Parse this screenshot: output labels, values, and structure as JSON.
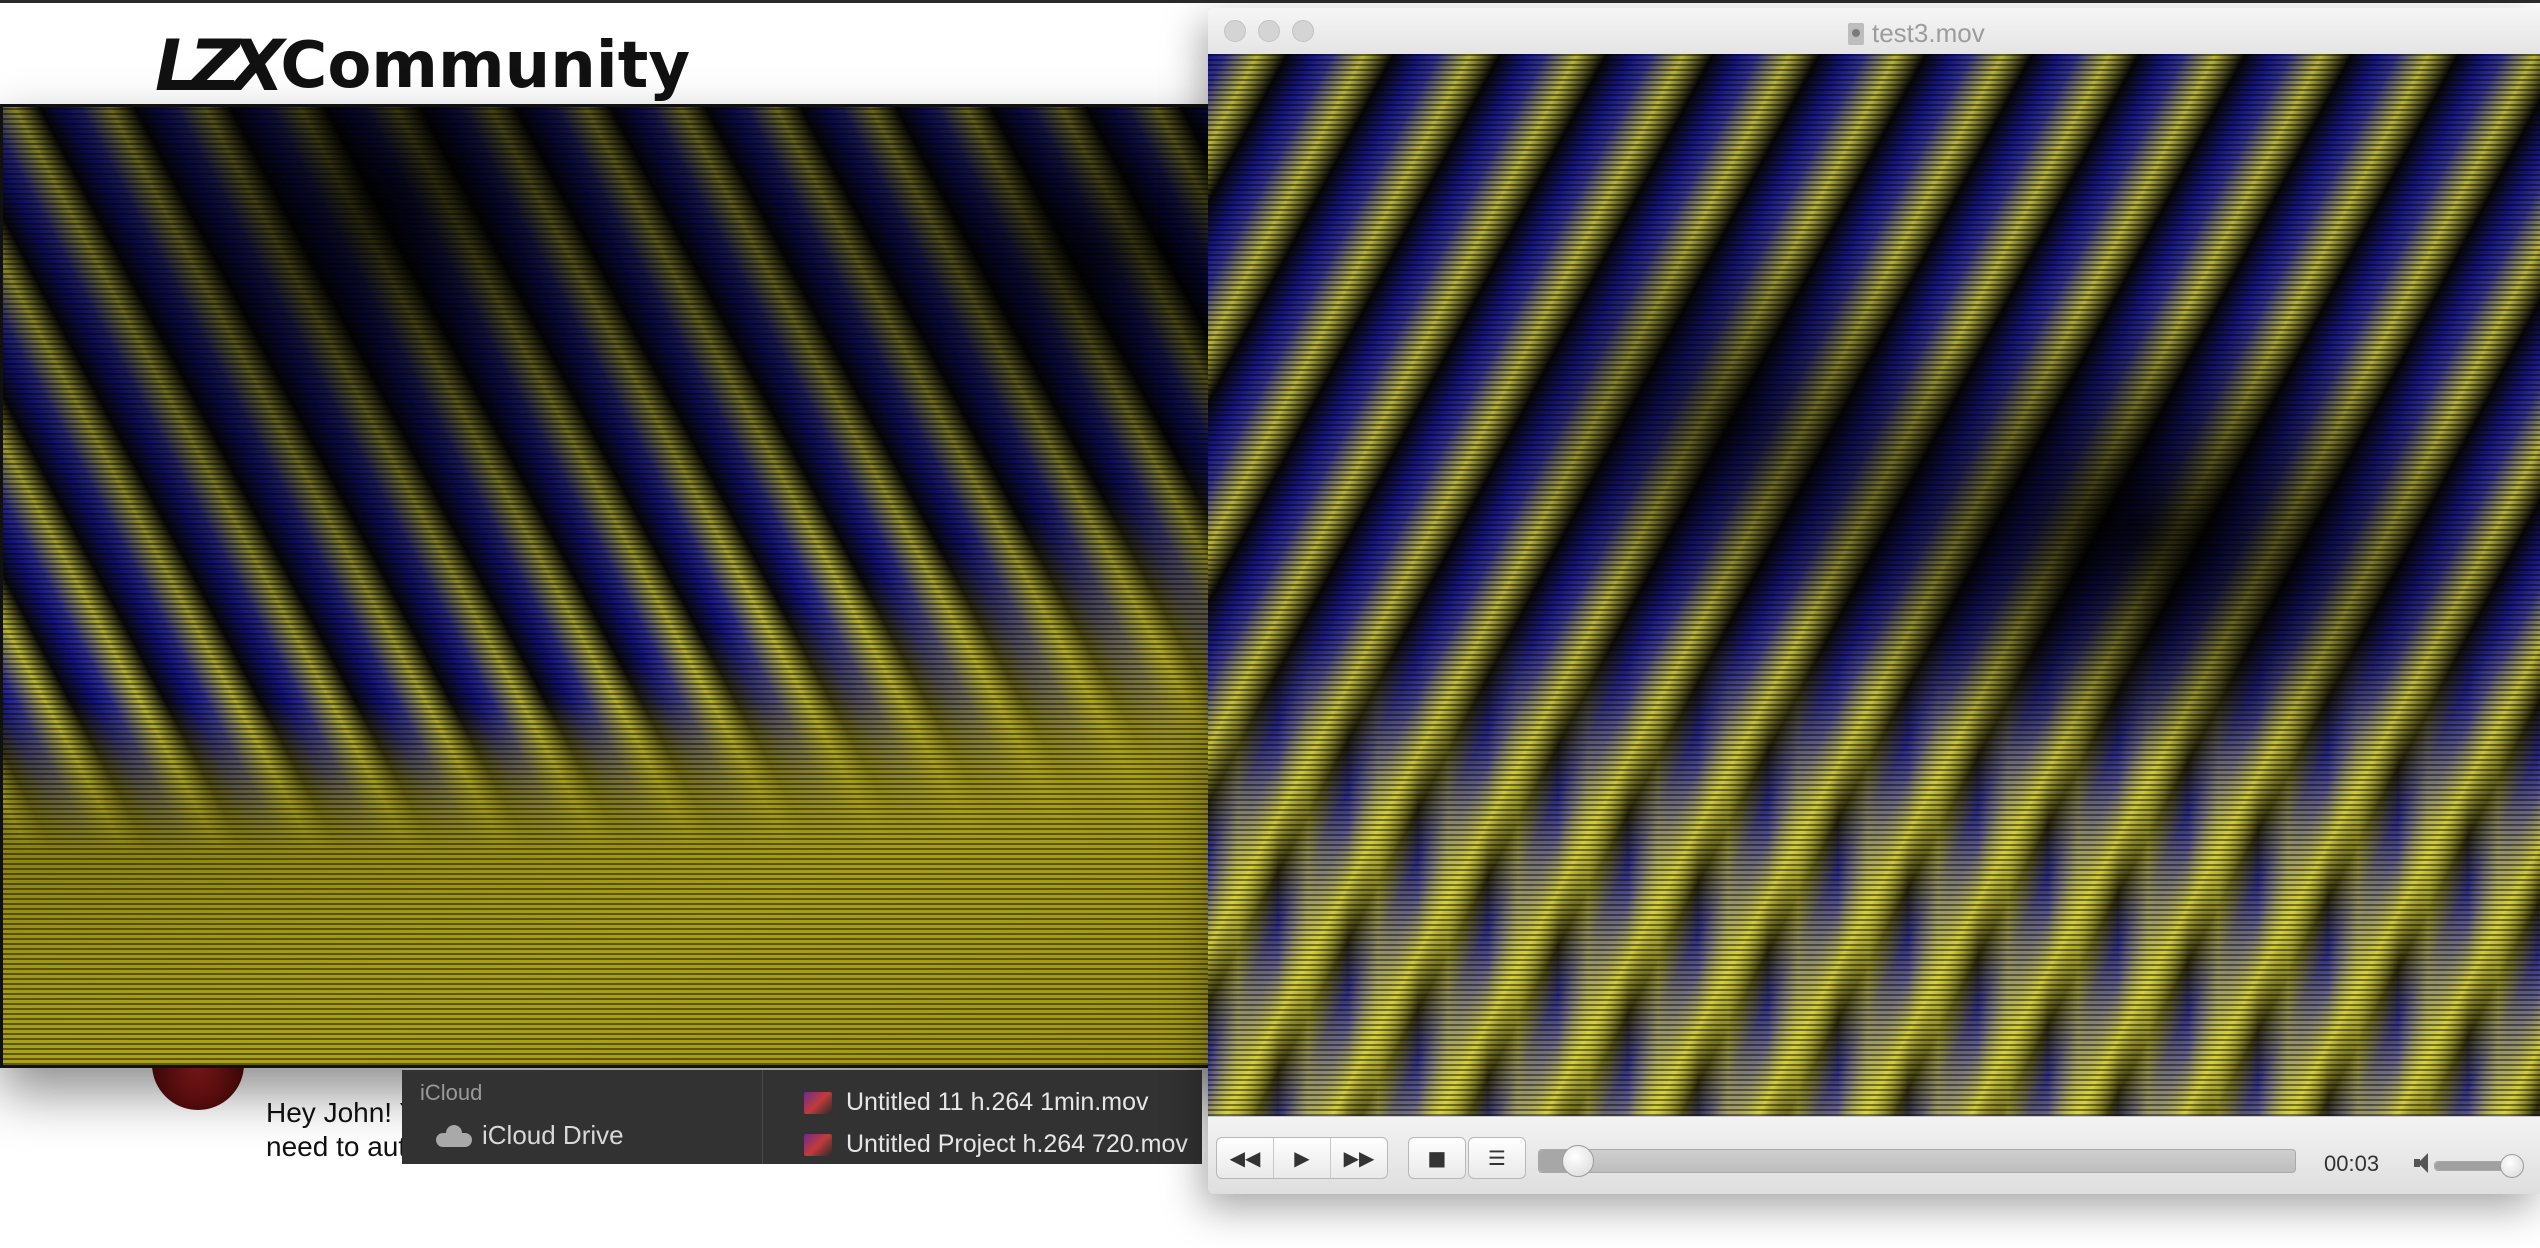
{
  "site": {
    "logo_mark": "LZX",
    "logo_text": "Community"
  },
  "post": {
    "line1": "Hey John! You",
    "line2": "need to author your own video content for the – let us know if we're mis"
  },
  "finder": {
    "section_label": "iCloud",
    "drive_label": "iCloud Drive",
    "files": [
      {
        "name": "Untitled 11 h.264 1min.mov"
      },
      {
        "name": "Untitled Project h.264 720.mov"
      }
    ]
  },
  "player": {
    "title": "test3.mov",
    "buttons": {
      "rewind": "◀◀",
      "play": "▶",
      "fast_forward": "▶▶",
      "stop": "■",
      "playlist": "☰"
    },
    "time": "00:03",
    "progress": 0.05,
    "volume": 0.9
  },
  "colors": {
    "video_yellow": "#d8d03c",
    "video_blue": "#1f1fa0",
    "finder_bg": "#323232"
  }
}
